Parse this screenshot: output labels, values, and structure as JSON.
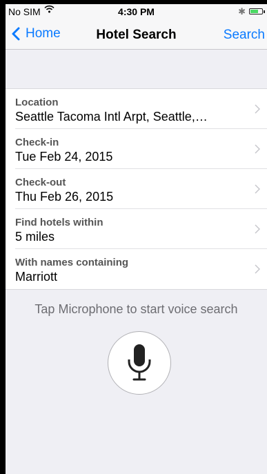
{
  "status_bar": {
    "carrier": "No SIM",
    "time": "4:30 PM",
    "battery_level": 0.7
  },
  "nav": {
    "back_label": "Home",
    "title": "Hotel Search",
    "right_button": "Search"
  },
  "form": {
    "rows": [
      {
        "label": "Location",
        "value": "Seattle Tacoma Intl Arpt, Seattle,…"
      },
      {
        "label": "Check-in",
        "value": "Tue Feb 24, 2015"
      },
      {
        "label": "Check-out",
        "value": "Thu Feb 26, 2015"
      },
      {
        "label": "Find hotels within",
        "value": "5 miles"
      },
      {
        "label": "With names containing",
        "value": "Marriott"
      }
    ]
  },
  "voice": {
    "hint": "Tap Microphone to start voice search"
  },
  "colors": {
    "accent": "#0a7aff",
    "background": "#efeff4"
  },
  "icons": [
    "wifi-icon",
    "bluetooth-icon",
    "battery-icon",
    "back-chevron-icon",
    "chevron-right-icon",
    "microphone-icon"
  ]
}
